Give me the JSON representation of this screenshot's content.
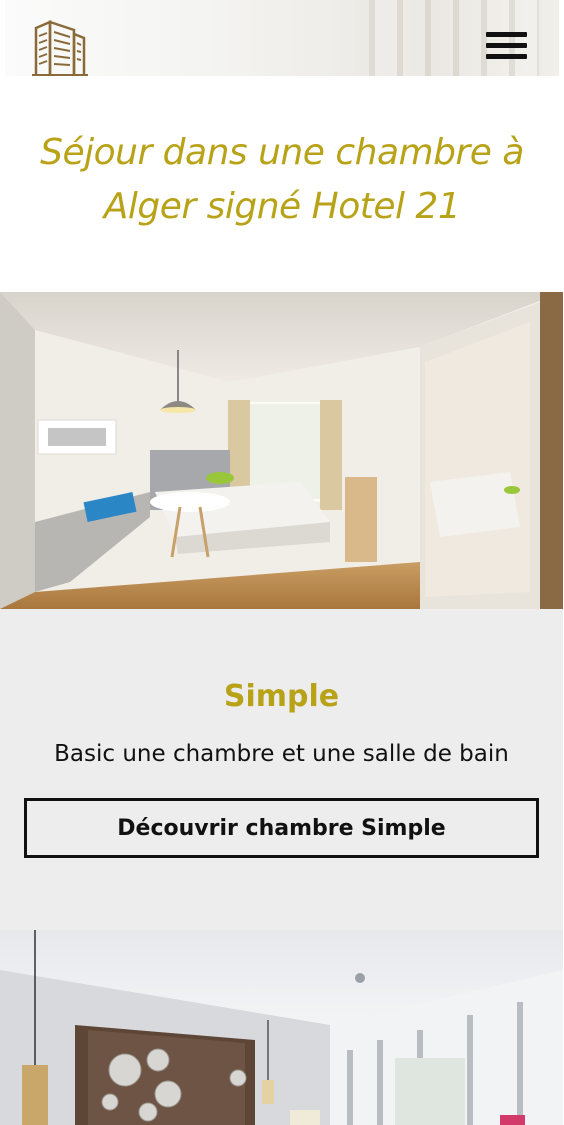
{
  "header": {
    "logo_icon": "hotel-building-logo",
    "menu_icon": "hamburger-menu-icon",
    "brand_color": "#b8a218"
  },
  "hero": {
    "title": "Séjour dans une chambre à Alger signé Hotel 21"
  },
  "rooms": [
    {
      "name": "Simple",
      "description": "Basic une chambre et une salle de bain",
      "cta_label": "Découvrir chambre Simple",
      "image_icon": "hotel-room-photo"
    }
  ],
  "next_room": {
    "image_icon": "hotel-room-photo-2"
  }
}
